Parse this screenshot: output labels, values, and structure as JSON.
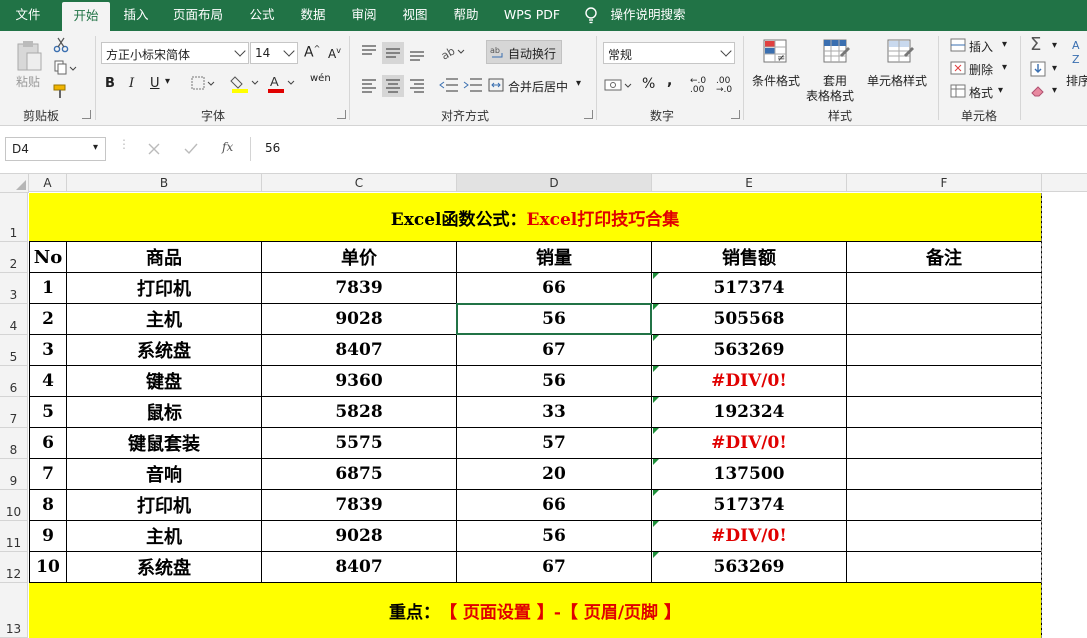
{
  "tabs": [
    "文件",
    "开始",
    "插入",
    "页面布局",
    "公式",
    "数据",
    "审阅",
    "视图",
    "帮助",
    "WPS PDF",
    "操作说明搜索"
  ],
  "ribbon": {
    "clipboard": {
      "paste": "粘贴",
      "group": "剪贴板"
    },
    "font": {
      "name": "方正小标宋简体",
      "size": "14",
      "bold": "B",
      "italic": "I",
      "underline": "U",
      "group": "字体",
      "grow": "A",
      "shrink": "A",
      "wen": "wén"
    },
    "align": {
      "wrap": "自动换行",
      "merge": "合并后居中",
      "group": "对齐方式"
    },
    "number": {
      "format": "常规",
      "percent": "%",
      "comma": ",",
      "group": "数字",
      "inc": "←.0 .00",
      "dec": ".00 →.0"
    },
    "styles": {
      "cond": "条件格式",
      "table1": "套用",
      "table2": "表格格式",
      "cell": "单元格样式",
      "group": "样式"
    },
    "cells": {
      "insert": "插入",
      "delete": "删除",
      "format": "格式",
      "group": "单元格"
    },
    "editing": {
      "sort": "排序"
    }
  },
  "formula_bar": {
    "name_box": "D4",
    "fx": "fx",
    "value": "56"
  },
  "columns": [
    "A",
    "B",
    "C",
    "D",
    "E",
    "F"
  ],
  "rows": [
    "1",
    "2",
    "3",
    "4",
    "5",
    "6",
    "7",
    "8",
    "9",
    "10",
    "11",
    "12",
    "13"
  ],
  "sheet": {
    "title_black": "Excel函数公式：",
    "title_red": "Excel打印技巧合集",
    "headers": [
      "No",
      "商品",
      "单价",
      "销量",
      "销售额",
      "备注"
    ],
    "data": [
      {
        "no": "1",
        "item": "打印机",
        "price": "7839",
        "qty": "66",
        "sales": "517374",
        "note": ""
      },
      {
        "no": "2",
        "item": "主机",
        "price": "9028",
        "qty": "56",
        "sales": "505568",
        "note": ""
      },
      {
        "no": "3",
        "item": "系统盘",
        "price": "8407",
        "qty": "67",
        "sales": "563269",
        "note": ""
      },
      {
        "no": "4",
        "item": "键盘",
        "price": "9360",
        "qty": "56",
        "sales": "#DIV/0!",
        "note": ""
      },
      {
        "no": "5",
        "item": "鼠标",
        "price": "5828",
        "qty": "33",
        "sales": "192324",
        "note": ""
      },
      {
        "no": "6",
        "item": "键鼠套装",
        "price": "5575",
        "qty": "57",
        "sales": "#DIV/0!",
        "note": ""
      },
      {
        "no": "7",
        "item": "音响",
        "price": "6875",
        "qty": "20",
        "sales": "137500",
        "note": ""
      },
      {
        "no": "8",
        "item": "打印机",
        "price": "7839",
        "qty": "66",
        "sales": "517374",
        "note": ""
      },
      {
        "no": "9",
        "item": "主机",
        "price": "9028",
        "qty": "56",
        "sales": "#DIV/0!",
        "note": ""
      },
      {
        "no": "10",
        "item": "系统盘",
        "price": "8407",
        "qty": "67",
        "sales": "563269",
        "note": ""
      }
    ],
    "footer_black": "重点：",
    "footer_red": "【 页面设置 】-【 页眉/页脚 】"
  },
  "colors": {
    "excel_green": "#217346",
    "highlight": "#ffff00",
    "error_red": "#e00000",
    "font_red": "#e00000"
  }
}
